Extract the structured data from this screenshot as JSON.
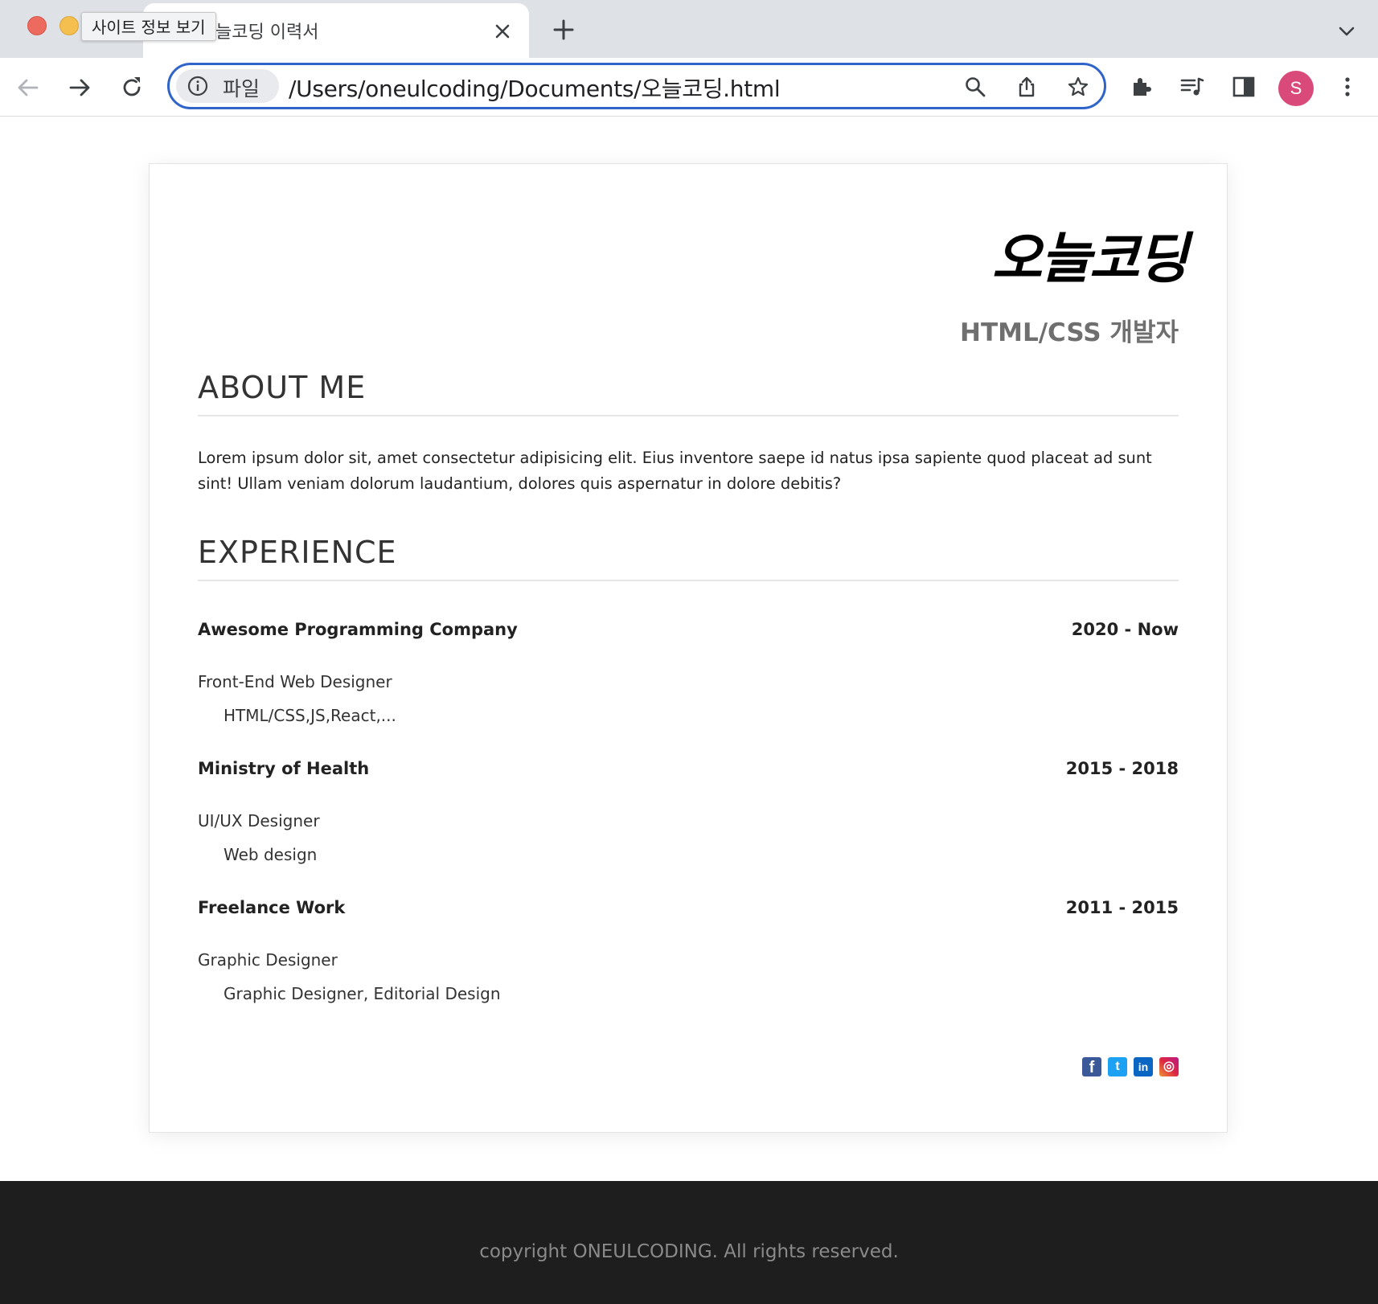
{
  "browser": {
    "tab_title": "늘코딩 이력서",
    "tooltip": "사이트 정보 보기",
    "site_chip_label": "파일",
    "url": "/Users/oneulcoding/Documents/오늘코딩.html",
    "profile_initial": "S"
  },
  "resume": {
    "name": "오늘코딩",
    "role": "HTML/CSS 개발자",
    "about": {
      "heading": "ABOUT ME",
      "text": "Lorem ipsum dolor sit, amet consectetur adipisicing elit. Eius inventore saepe id natus ipsa sapiente quod placeat ad sunt sint! Ullam veniam dolorum laudantium, dolores quis aspernatur in dolore debitis?"
    },
    "experience": {
      "heading": "EXPERIENCE",
      "jobs": [
        {
          "company": "Awesome Programming Company",
          "period": "2020 - Now",
          "title": "Front-End Web Designer",
          "desc": "HTML/CSS,JS,React,..."
        },
        {
          "company": "Ministry of Health",
          "period": "2015 - 2018",
          "title": "UI/UX Designer",
          "desc": "Web design"
        },
        {
          "company": "Freelance Work",
          "period": "2011 - 2015",
          "title": "Graphic Designer",
          "desc": "Graphic Designer, Editorial Design"
        }
      ]
    },
    "social": [
      {
        "icon": "facebook-icon",
        "glyph": "f",
        "color": "#3b5998"
      },
      {
        "icon": "twitter-icon",
        "glyph": "t",
        "color": "#1da1f2"
      },
      {
        "icon": "linkedin-icon",
        "glyph": "in",
        "color": "#0a66c2"
      },
      {
        "icon": "instagram-icon",
        "glyph": "◎",
        "color": "#c13584"
      }
    ]
  },
  "footer": {
    "text": "copyright ONEULCODING. All rights reserved."
  }
}
